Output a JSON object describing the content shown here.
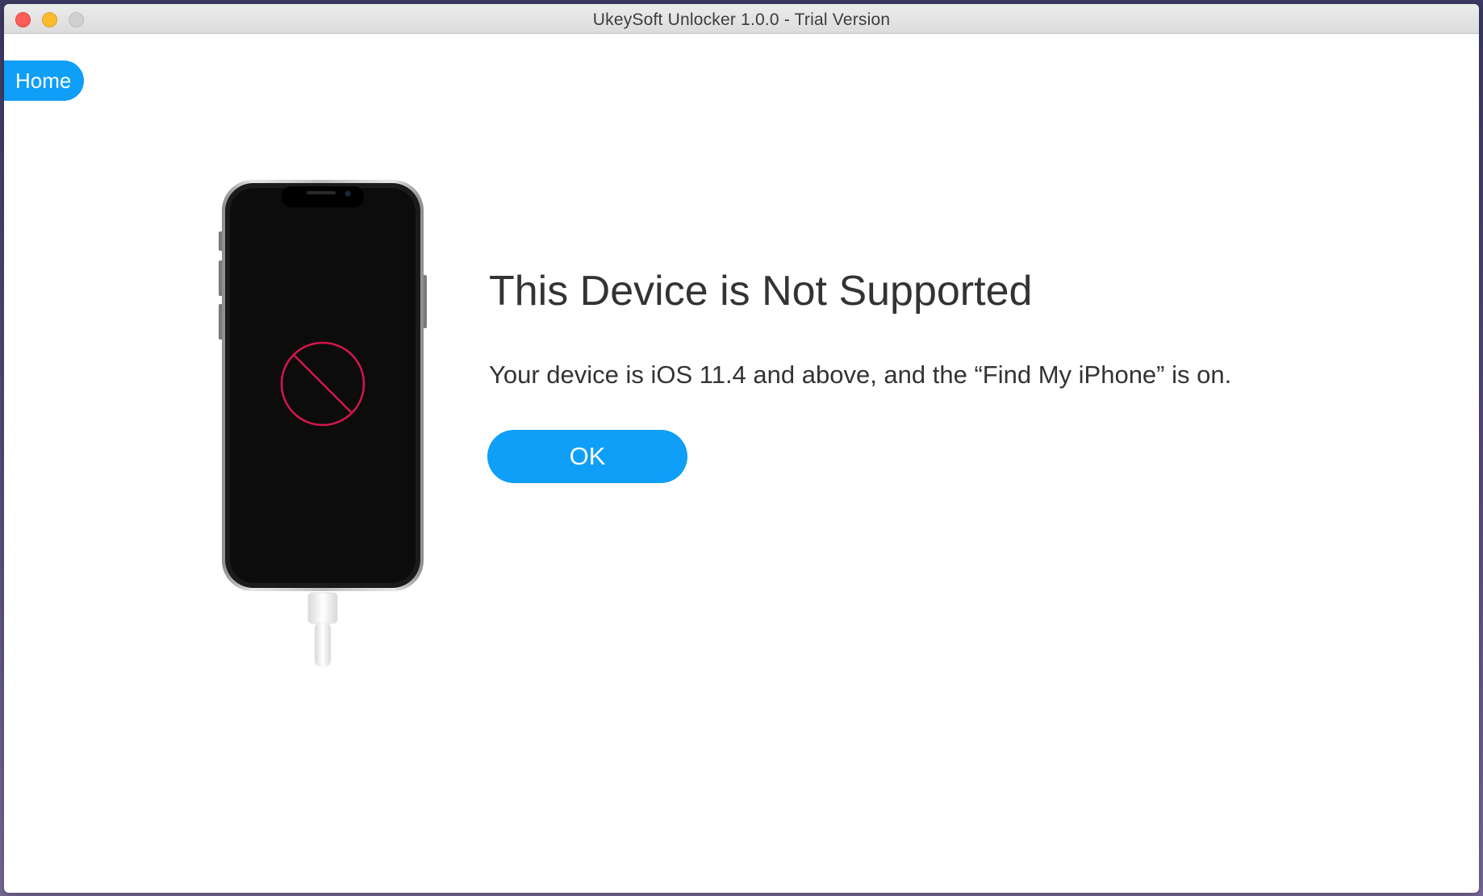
{
  "window": {
    "title": "UkeySoft Unlocker 1.0.0 - Trial Version"
  },
  "nav": {
    "home_label": "Home"
  },
  "dialog": {
    "headline": "This Device is Not Supported",
    "message": "Your device is iOS 11.4 and above, and the “Find My iPhone” is on.",
    "ok_label": "OK"
  },
  "icons": {
    "phone": "iphone-connected-icon",
    "status": "prohibited-icon"
  },
  "colors": {
    "accent": "#0f9ef8",
    "prohibited": "#d4174a",
    "text": "#333333"
  }
}
